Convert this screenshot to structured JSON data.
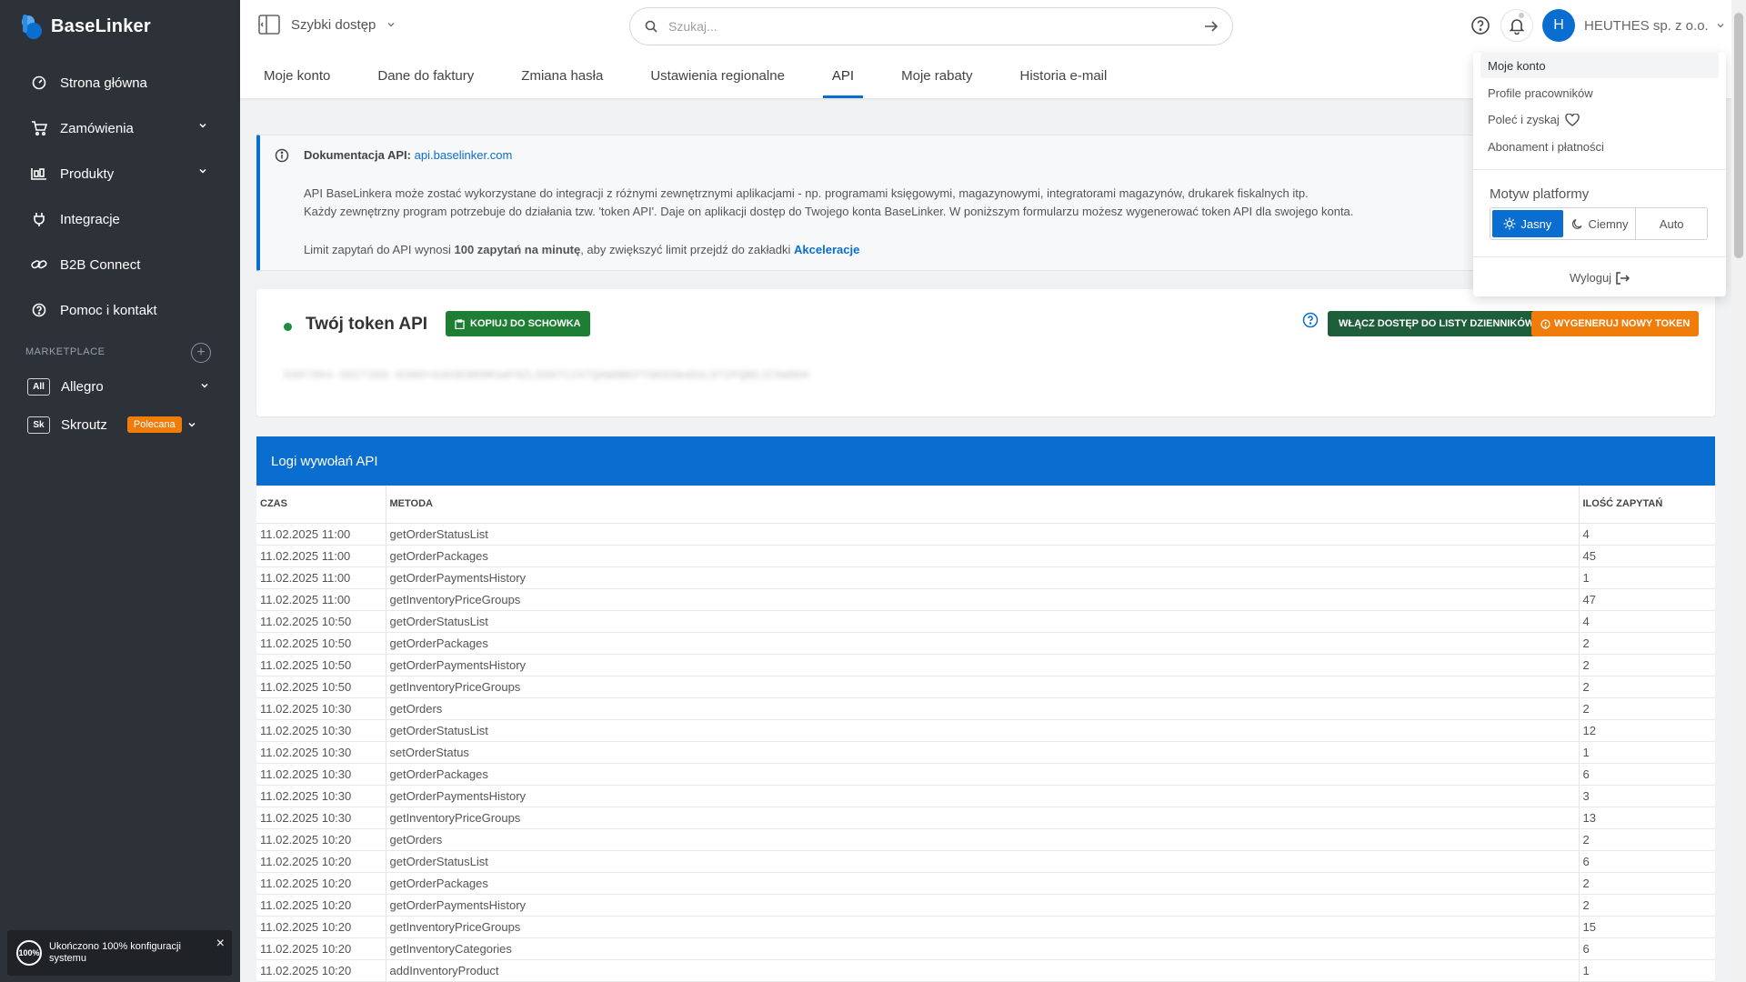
{
  "app": {
    "name": "BaseLinker"
  },
  "sidebar": {
    "items": [
      {
        "label": "Strona główna",
        "icon": "gauge-icon",
        "has_chevron": false
      },
      {
        "label": "Zamówienia",
        "icon": "cart-icon",
        "has_chevron": true
      },
      {
        "label": "Produkty",
        "icon": "products-icon",
        "has_chevron": true
      },
      {
        "label": "Integracje",
        "icon": "plug-icon",
        "has_chevron": false
      },
      {
        "label": "B2B Connect",
        "icon": "link-icon",
        "has_chevron": false
      },
      {
        "label": "Pomoc i kontakt",
        "icon": "help-icon",
        "has_chevron": false
      }
    ],
    "marketplace_title": "MARKETPLACE",
    "marketplaces": [
      {
        "badge": "All",
        "label": "Allegro"
      },
      {
        "badge": "Sk",
        "label": "Skroutz",
        "pill": "Polecana"
      }
    ],
    "notice": {
      "circle": "100%",
      "text": "Ukończono 100% konfiguracji systemu"
    }
  },
  "header": {
    "quick_access": "Szybki dostęp",
    "search_placeholder": "Szukaj...",
    "company": "HEUTHES sp. z o.o.",
    "avatar_letter": "H",
    "tabs": [
      {
        "label": "Moje konto"
      },
      {
        "label": "Dane do faktury"
      },
      {
        "label": "Zmiana hasła"
      },
      {
        "label": "Ustawienia regionalne"
      },
      {
        "label": "API",
        "active": true
      },
      {
        "label": "Moje rabaty"
      },
      {
        "label": "Historia e-mail"
      }
    ]
  },
  "info": {
    "title": "Dokumentacja API:",
    "link": "api.baselinker.com",
    "line1": "API BaseLinkera może zostać wykorzystane do integracji z różnymi zewnętrznymi aplikacjami - np. programami księgowymi, magazynowymi, integratorami magazynów, drukarek fiskalnych itp.",
    "line2": "Każdy zewnętrzny program potrzebuje do działania tzw. 'token API'. Daje on aplikacji dostęp do Twojego konta BaseLinker. W poniższym formularzu możesz wygenerować token API dla swojego konta.",
    "limit_pre": "Limit zapytań do API wynosi",
    "limit_bold": "100 zapytań na minutę",
    "limit_mid": ", aby zwiększyć limit przejdź do zakładki",
    "limit_link": "Akceleracje"
  },
  "token": {
    "title": "Twój token API",
    "copy_button": "KOPIUJ DO SCHOWKA",
    "logs_button": "WŁĄCZ DOSTĘP DO LISTY DZIENNIKÓW",
    "regen_button": "WYGENERUJ NOWY TOKEN",
    "value": "5007964-5027399-02N8Y4UH3E8R0M1WF0ZL09H7C2XTQAW8BEPTGK05N4DUL6T2PQBEJC5W8KH"
  },
  "logs": {
    "title": "Logi wywołań API",
    "columns": [
      "CZAS",
      "METODA",
      "ILOŚĆ ZAPYTAŃ"
    ],
    "rows": [
      [
        "11.02.2025 11:00",
        "getOrderStatusList",
        "4"
      ],
      [
        "11.02.2025 11:00",
        "getOrderPackages",
        "45"
      ],
      [
        "11.02.2025 11:00",
        "getOrderPaymentsHistory",
        "1"
      ],
      [
        "11.02.2025 11:00",
        "getInventoryPriceGroups",
        "47"
      ],
      [
        "11.02.2025 10:50",
        "getOrderStatusList",
        "4"
      ],
      [
        "11.02.2025 10:50",
        "getOrderPackages",
        "2"
      ],
      [
        "11.02.2025 10:50",
        "getOrderPaymentsHistory",
        "2"
      ],
      [
        "11.02.2025 10:50",
        "getInventoryPriceGroups",
        "2"
      ],
      [
        "11.02.2025 10:30",
        "getOrders",
        "2"
      ],
      [
        "11.02.2025 10:30",
        "getOrderStatusList",
        "12"
      ],
      [
        "11.02.2025 10:30",
        "setOrderStatus",
        "1"
      ],
      [
        "11.02.2025 10:30",
        "getOrderPackages",
        "6"
      ],
      [
        "11.02.2025 10:30",
        "getOrderPaymentsHistory",
        "3"
      ],
      [
        "11.02.2025 10:30",
        "getInventoryPriceGroups",
        "13"
      ],
      [
        "11.02.2025 10:20",
        "getOrders",
        "2"
      ],
      [
        "11.02.2025 10:20",
        "getOrderStatusList",
        "6"
      ],
      [
        "11.02.2025 10:20",
        "getOrderPackages",
        "2"
      ],
      [
        "11.02.2025 10:20",
        "getOrderPaymentsHistory",
        "2"
      ],
      [
        "11.02.2025 10:20",
        "getInventoryPriceGroups",
        "15"
      ],
      [
        "11.02.2025 10:20",
        "getInventoryCategories",
        "6"
      ],
      [
        "11.02.2025 10:20",
        "addInventoryProduct",
        "1"
      ]
    ]
  },
  "dropdown": {
    "items": [
      "Moje konto",
      "Profile pracowników",
      "Poleć i zyskaj",
      "Abonament i płatności"
    ],
    "theme_label": "Motyw platformy",
    "themes": [
      {
        "label": "Jasny",
        "active": true
      },
      {
        "label": "Ciemny"
      },
      {
        "label": "Auto"
      }
    ],
    "logout": "Wyloguj"
  },
  "colors": {
    "accent": "#0a6ed1",
    "sidebar": "#2d3239",
    "orange": "#f07c0a",
    "green": "#1e7e34"
  }
}
